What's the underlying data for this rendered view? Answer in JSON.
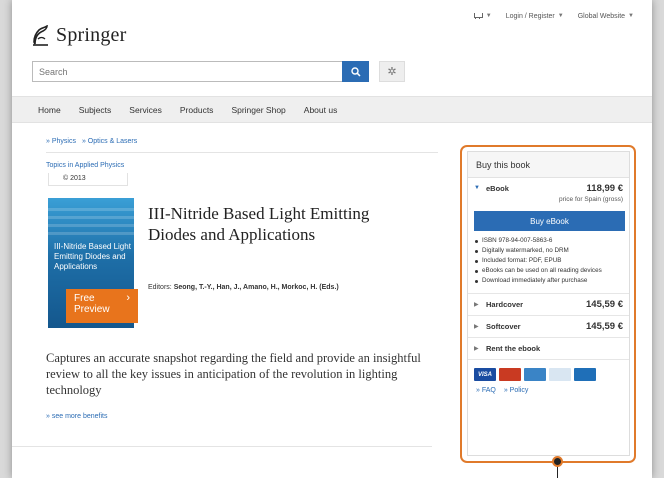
{
  "header": {
    "cart_caret": "▼",
    "login": "Login / Register",
    "global": "Global Website",
    "brand": "Springer",
    "search_placeholder": "Search"
  },
  "nav": [
    "Home",
    "Subjects",
    "Services",
    "Products",
    "Springer Shop",
    "About us"
  ],
  "breadcrumb": [
    "» Physics",
    "» Optics & Lasers"
  ],
  "series": "Topics in Applied Physics",
  "copyright": "© 2013",
  "book": {
    "cover_title": "III-Nitride Based Light Emitting Diodes and Applications",
    "preview": "Free Preview",
    "title": "III-Nitride Based Light Emitting Diodes and Applications",
    "editors_prefix": "Editors:",
    "editors": "Seong, T.-Y., Han, J., Amano, H., Morkoc, H. (Eds.)",
    "summary": "Captures an accurate snapshot regarding the field and provide an insightful review to all the key issues in anticipation of the revolution in lighting technology",
    "more": "» see more benefits"
  },
  "buybox": {
    "title": "Buy this book",
    "ebook_label": "eBook",
    "ebook_price": "118,99 €",
    "price_note": "price for Spain (gross)",
    "buy_button": "Buy eBook",
    "bullets": [
      "ISBN 978-94-007-5863-6",
      "Digitally watermarked, no DRM",
      "Included format: PDF, EPUB",
      "eBooks can be used on all reading devices",
      "Download immediately after purchase"
    ],
    "hardcover_label": "Hardcover",
    "hardcover_price": "145,59 €",
    "softcover_label": "Softcover",
    "softcover_price": "145,59 €",
    "rent_label": "Rent the ebook",
    "faq": "» FAQ",
    "policy": "» Policy"
  },
  "colors": {
    "accent": "#2b6cb4",
    "highlight": "#e07a2b",
    "preview": "#e8741c"
  }
}
